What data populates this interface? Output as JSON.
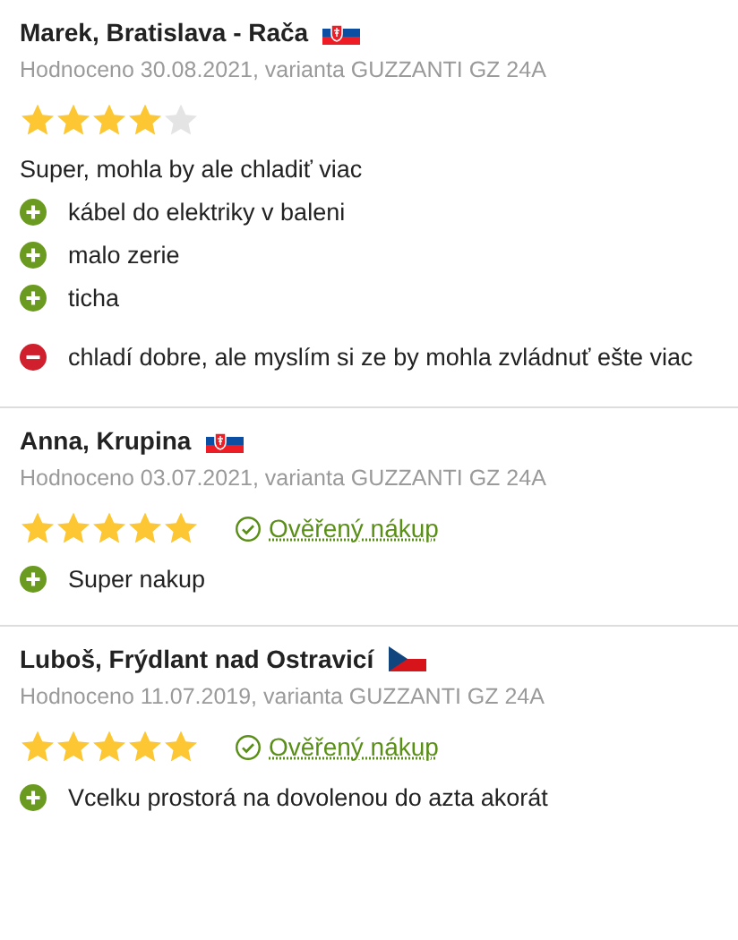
{
  "reviews": [
    {
      "author": "Marek, Bratislava - Rača",
      "flag": {
        "kind": "sk"
      },
      "meta": "Hodnoceno 30.08.2021, varianta GUZZANTI GZ 24A",
      "stars": 4,
      "verified": false,
      "comment": "Super, mohla by ale chladiť viac",
      "points": [
        {
          "kind": "pro",
          "text": "kábel do elektriky v baleni"
        },
        {
          "kind": "pro",
          "text": "malo zerie"
        },
        {
          "kind": "pro",
          "text": "ticha"
        },
        {
          "kind": "con",
          "text": "chladí dobre, ale myslím si ze by mohla zvládnuť ešte viac"
        }
      ]
    },
    {
      "author": "Anna, Krupina",
      "flag": {
        "kind": "sk"
      },
      "meta": "Hodnoceno 03.07.2021, varianta GUZZANTI GZ 24A",
      "stars": 5,
      "verified": true,
      "verified_label": "Ověřený nákup",
      "points": [
        {
          "kind": "pro",
          "text": "Super nakup"
        }
      ]
    },
    {
      "author": "Luboš, Frýdlant nad Ostravicí",
      "flag": {
        "kind": "cz"
      },
      "meta": "Hodnoceno 11.07.2019, varianta GUZZANTI GZ 24A",
      "stars": 5,
      "verified": true,
      "verified_label": "Ověřený nákup",
      "points": [
        {
          "kind": "pro",
          "text": "Vcelku prostorá na dovolenou do azta akorát"
        }
      ]
    }
  ]
}
